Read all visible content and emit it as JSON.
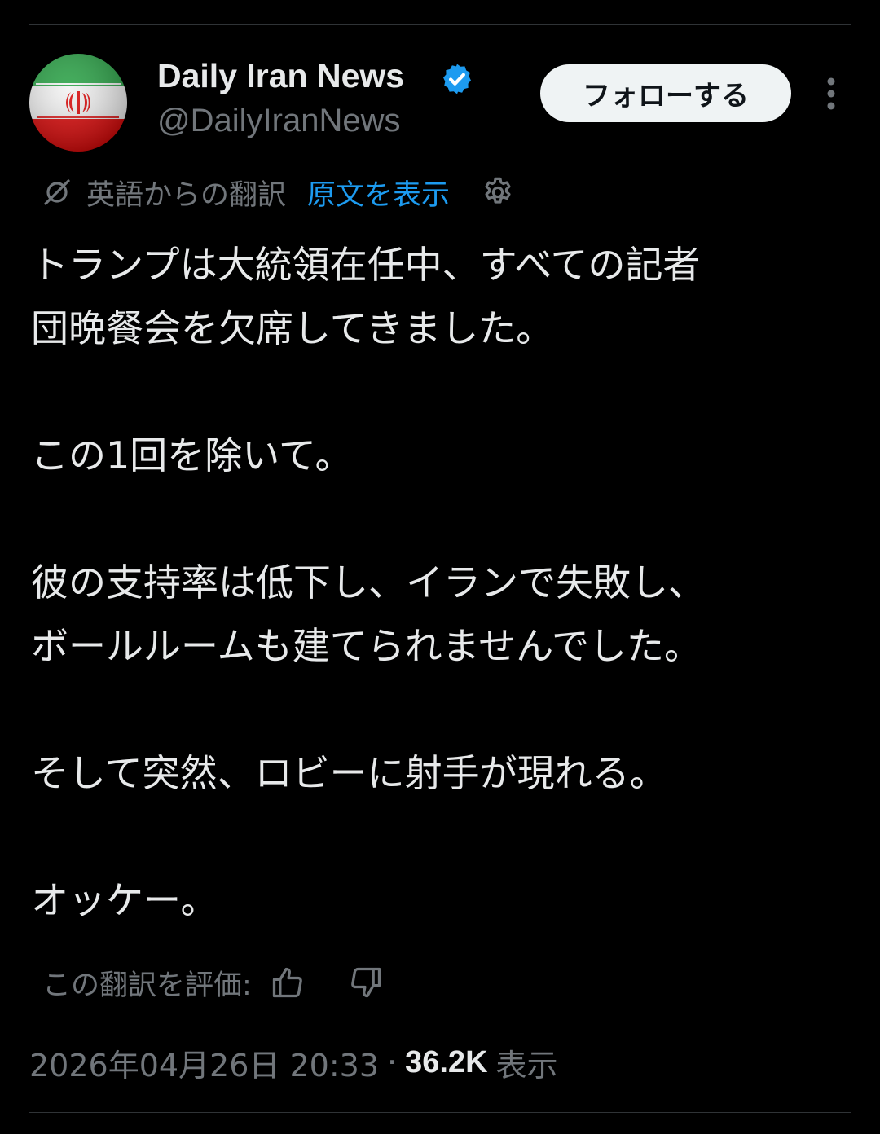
{
  "author": {
    "display_name": "Daily Iran News",
    "handle": "@DailyIranNews",
    "verified": true,
    "avatar": "iran-flag-avatar"
  },
  "actions": {
    "follow_label": "フォローする",
    "more_icon": "more-vertical-icon"
  },
  "translation": {
    "label": "英語からの翻訳",
    "show_original": "原文を表示",
    "settings_icon": "gear-icon"
  },
  "tweet": {
    "paragraphs": [
      "トランプは大統領在任中、すべての記者\n団晩餐会を欠席してきました。",
      "この1回を除いて。",
      "彼の支持率は低下し、イランで失敗し、\nボールルームも建てられませんでした。",
      "そして突然、ロビーに射手が現れる。",
      "オッケー。"
    ]
  },
  "rating": {
    "label": "この翻訳を評価:",
    "up_icon": "thumbs-up-icon",
    "down_icon": "thumbs-down-icon"
  },
  "meta": {
    "timestamp": "2026年04月26日 20:33",
    "separator": "·",
    "views_count": "36.2K",
    "views_label": "表示"
  },
  "colors": {
    "background": "#000000",
    "text": "#e7e9ea",
    "muted": "#71767b",
    "accent": "#1d9bf0",
    "follow_button_bg": "#eff3f4"
  }
}
